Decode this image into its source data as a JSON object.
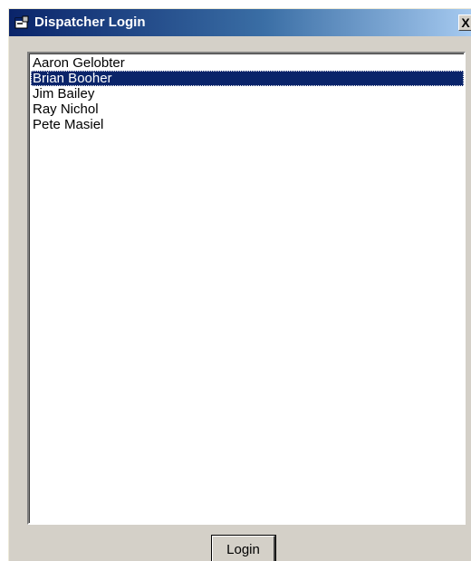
{
  "window": {
    "title": "Dispatcher Login",
    "icon": "app-window-icon",
    "close_label": "X"
  },
  "list": {
    "items": [
      {
        "label": "Aaron Gelobter",
        "selected": false
      },
      {
        "label": "Brian Booher",
        "selected": true
      },
      {
        "label": "Jim Bailey",
        "selected": false
      },
      {
        "label": "Ray Nichol",
        "selected": false
      },
      {
        "label": "Pete Masiel",
        "selected": false
      }
    ],
    "selected_color": "#0a246a"
  },
  "login_button": {
    "label": "Login"
  },
  "colors": {
    "titlebar_start": "#0a246a",
    "titlebar_end": "#a6caf0",
    "face": "#d4d0c8"
  }
}
